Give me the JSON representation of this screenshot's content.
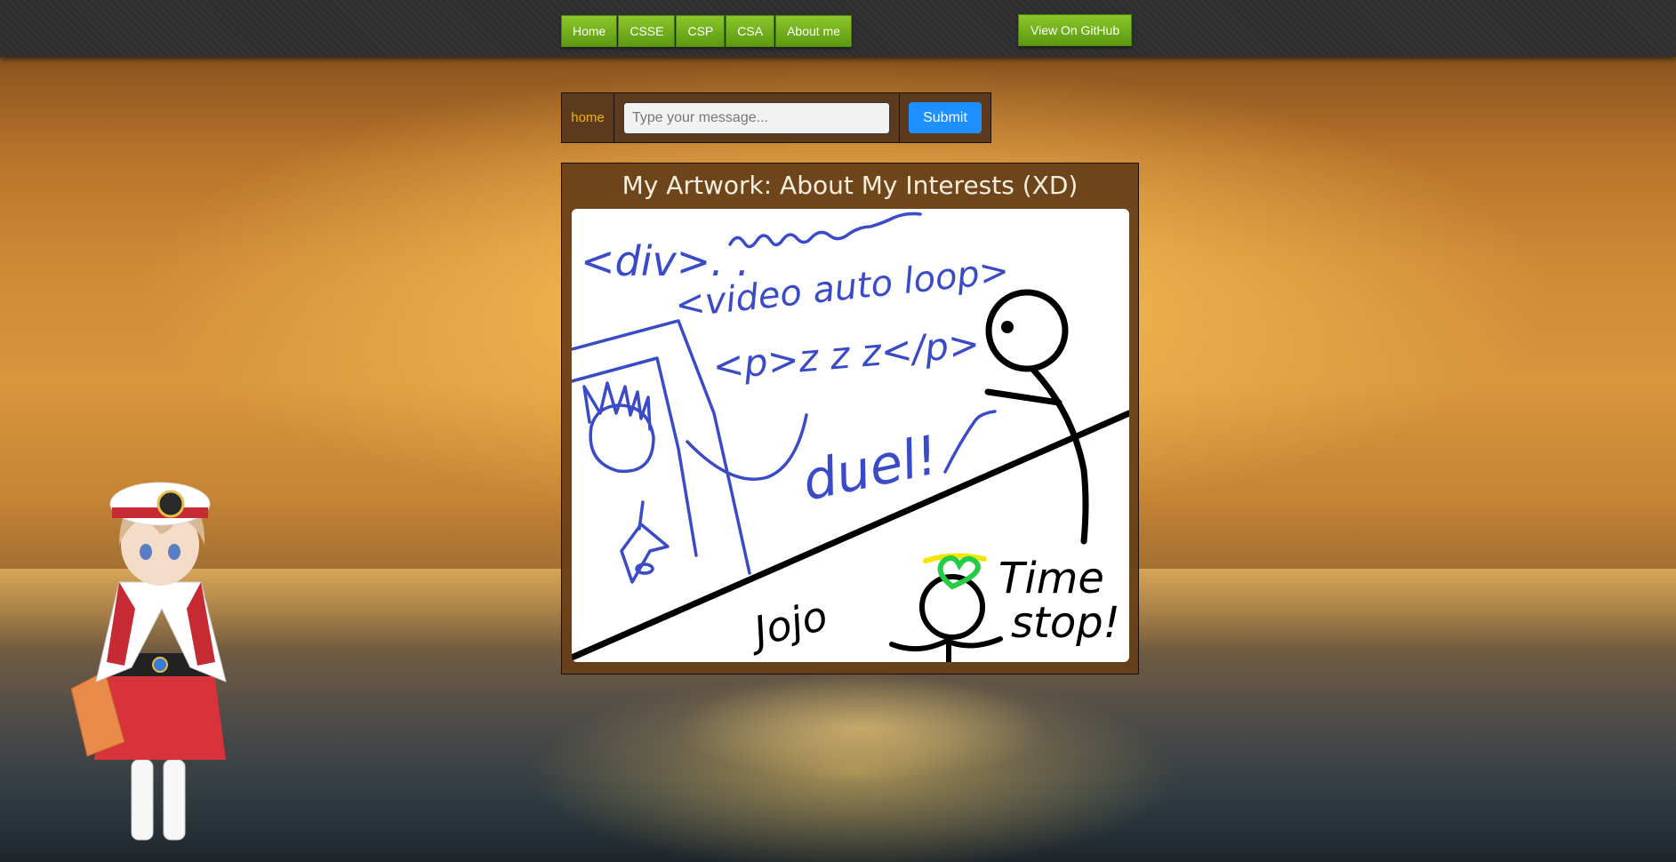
{
  "nav": {
    "items": [
      {
        "label": "Home"
      },
      {
        "label": "CSSE"
      },
      {
        "label": "CSP"
      },
      {
        "label": "CSA"
      },
      {
        "label": "About me"
      }
    ],
    "github_label": "View On GitHub"
  },
  "message_bar": {
    "home_label": "home",
    "input_placeholder": "Type your message...",
    "input_value": "",
    "submit_label": "Submit"
  },
  "artwork": {
    "title": "My Artwork: About My Interests (XD)",
    "drawing_text": {
      "div": "<div>. .",
      "video": "<video auto loop>",
      "p": "<p>z z z</p>",
      "duel": "duel!",
      "jojo": "Jojo",
      "time": "Time",
      "stop": "stop!"
    }
  },
  "colors": {
    "nav_green": "#7ab520",
    "submit_blue": "#1e8fff",
    "home_text": "#f4b400",
    "ink_blue": "#3a4bc8",
    "ink_black": "#000000",
    "heart_green": "#22cc44",
    "halo_yellow": "#f5e600"
  }
}
